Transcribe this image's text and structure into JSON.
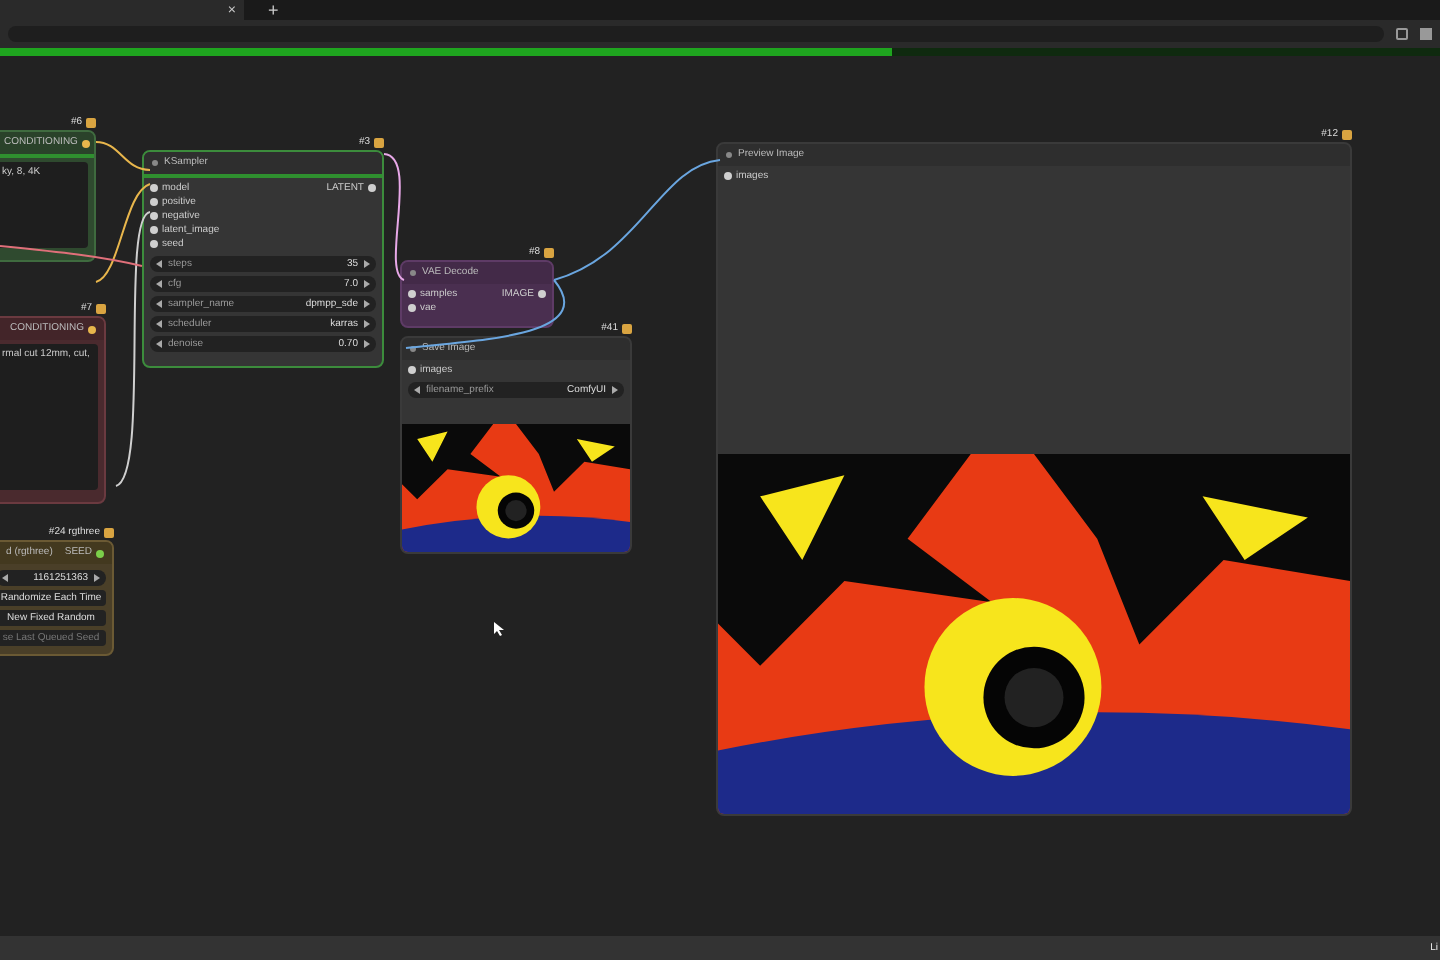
{
  "browser": {
    "tab_close": "×",
    "new_tab": "+",
    "progress": {
      "level": 0.62
    }
  },
  "nodes": [
    {
      "kind": "conditioning",
      "badge": "#6",
      "outputs": [
        "CONDITIONING"
      ],
      "text": "ky, 8, 4K"
    },
    {
      "kind": "sampler",
      "badge": "#3",
      "title": "KSampler",
      "inputs": [
        "model",
        "positive",
        "negative",
        "latent_image",
        "seed"
      ],
      "outputs": [
        "LATENT"
      ],
      "widgets": [
        {
          "label": "steps",
          "value": "35"
        },
        {
          "label": "cfg",
          "value": "7.0"
        },
        {
          "label": "sampler_name",
          "value": "dpmpp_sde"
        },
        {
          "label": "scheduler",
          "value": "karras"
        },
        {
          "label": "denoise",
          "value": "0.70"
        }
      ]
    },
    {
      "kind": "negative",
      "badge": "#7",
      "outputs": [
        "CONDITIONING"
      ],
      "text": "rmal cut 12mm, cut,"
    },
    {
      "kind": "seed",
      "badge": "#24 rgthree",
      "title": "d (rgthree)",
      "outputs": [
        "SEED"
      ],
      "widgets": [
        {
          "value": "1161251363"
        }
      ],
      "buttons": [
        {
          "label": "Randomize Each Time",
          "disabled": false
        },
        {
          "label": "New Fixed Random",
          "disabled": false
        },
        {
          "label": "se Last Queued Seed",
          "disabled": true
        }
      ]
    },
    {
      "kind": "vae",
      "badge": "#8",
      "title": "VAE Decode",
      "inputs": [
        "samples",
        "vae"
      ],
      "outputs": [
        "IMAGE"
      ]
    },
    {
      "kind": "save",
      "badge": "#41",
      "title": "Save Image",
      "inputs": [
        "images"
      ],
      "widgets": [
        {
          "label": "filename_prefix",
          "value": "ComfyUI"
        }
      ]
    },
    {
      "kind": "preview",
      "badge": "#12",
      "title": "Preview Image",
      "inputs": [
        "images"
      ]
    }
  ],
  "status_bar": {
    "text": "Li"
  }
}
